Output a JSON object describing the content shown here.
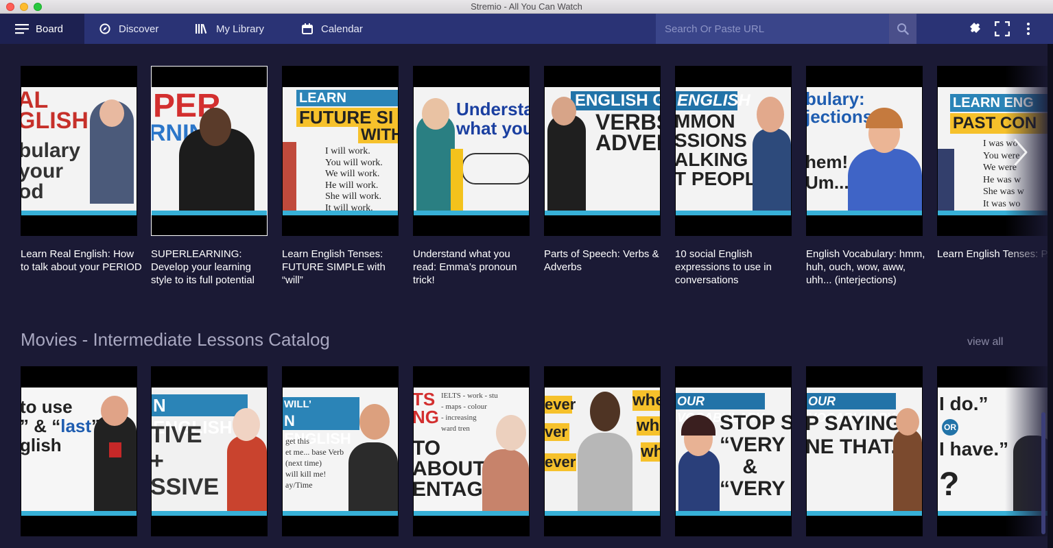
{
  "window": {
    "title": "Stremio - All You Can Watch"
  },
  "nav": {
    "board": "Board",
    "discover": "Discover",
    "library": "My Library",
    "calendar": "Calendar",
    "search_placeholder": "Search Or Paste URL"
  },
  "row1": {
    "cards": [
      {
        "title": "Learn Real English: How to talk about your PERIOD",
        "thumb_text": "AL GLISH bulary your od"
      },
      {
        "title": "SUPERLEARNING: Develop your learning style to its full potential",
        "thumb_text": "PER RNING"
      },
      {
        "title": "Learn English Tenses: FUTURE SIMPLE with “will”",
        "thumb_text": "LEARN ENGLISH FUTURE SI WITH"
      },
      {
        "title": "Understand what you read: Emma’s pronoun trick!",
        "thumb_text": "Understa what you"
      },
      {
        "title": "Parts of Speech: Verbs & Adverbs",
        "thumb_text": "ENGLISH GRA VERBS ADVER"
      },
      {
        "title": "10 social English expressions to use in conversations",
        "thumb_text": "ENGLISH MMON SSIONS ALKING T PEOPLE"
      },
      {
        "title": "English Vocabulary: hmm, huh, ouch, wow, aww, uhh... (interjections)",
        "thumb_text": "bulary: jections hem! Um..."
      },
      {
        "title": "Learn English Tenses: PAST CONTINUOUS",
        "thumb_text": "LEARN ENG PAST CON"
      }
    ]
  },
  "section2": {
    "title": "Movies - Intermediate Lessons Catalog",
    "view_all": "view all",
    "cards": [
      {
        "thumb_text": "to use ” & “last” glish"
      },
      {
        "thumb_text": "N ENGLISH TIVE + SSIVE"
      },
      {
        "thumb_text": "WILL SENTENCES N ENGLISH"
      },
      {
        "thumb_text": "TS NG TO ABOUT ENTAGES"
      },
      {
        "thumb_text": "ever ver ever whe wh wh"
      },
      {
        "thumb_text": "OUR VOCABULARY STOP SA “VERY G & “VERY"
      },
      {
        "thumb_text": "OUR VOCABULARY P SAYING NE THAT.”"
      },
      {
        "thumb_text": "I do.” OR I have.” ?"
      }
    ]
  },
  "colors": {
    "navbar": "#2a3375",
    "board_active": "#1d2151",
    "background": "#1b1a35",
    "accent_stripe": "#37b0d7"
  }
}
